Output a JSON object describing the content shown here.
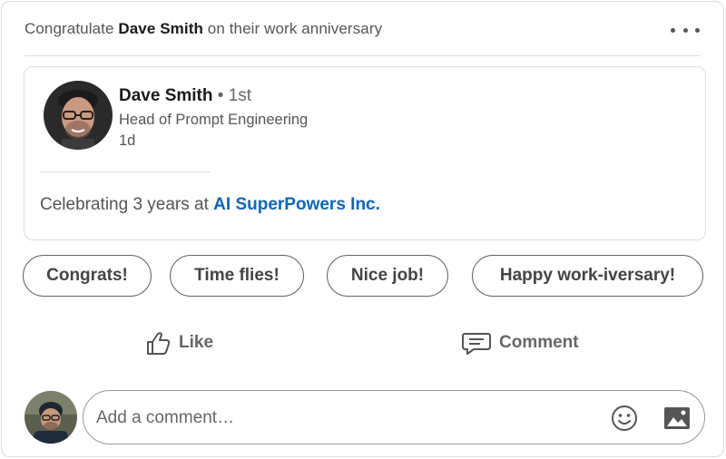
{
  "header": {
    "prefix": "Congratulate",
    "name": "Dave Smith",
    "suffix": "on their work anniversary",
    "more_icon": "more-horizontal-icon"
  },
  "profile": {
    "name": "Dave Smith",
    "degree": "• 1st",
    "headline": "Head of Prompt Engineering",
    "time": "1d",
    "celebration_prefix": "Celebrating 3 years at",
    "company": "AI SuperPowers Inc."
  },
  "chips": [
    {
      "label": "Congrats!"
    },
    {
      "label": "Time flies!"
    },
    {
      "label": "Nice job!"
    },
    {
      "label": "Happy work-iversary!"
    }
  ],
  "actions": {
    "like_label": "Like",
    "like_icon": "thumbs-up-icon",
    "comment_label": "Comment",
    "comment_icon": "comment-icon"
  },
  "comment_box": {
    "placeholder": "Add a comment…",
    "emoji_icon": "emoji-icon",
    "image_icon": "image-icon"
  },
  "colors": {
    "link": "#0a66c2",
    "text_muted": "#555555",
    "border": "#dedede"
  }
}
